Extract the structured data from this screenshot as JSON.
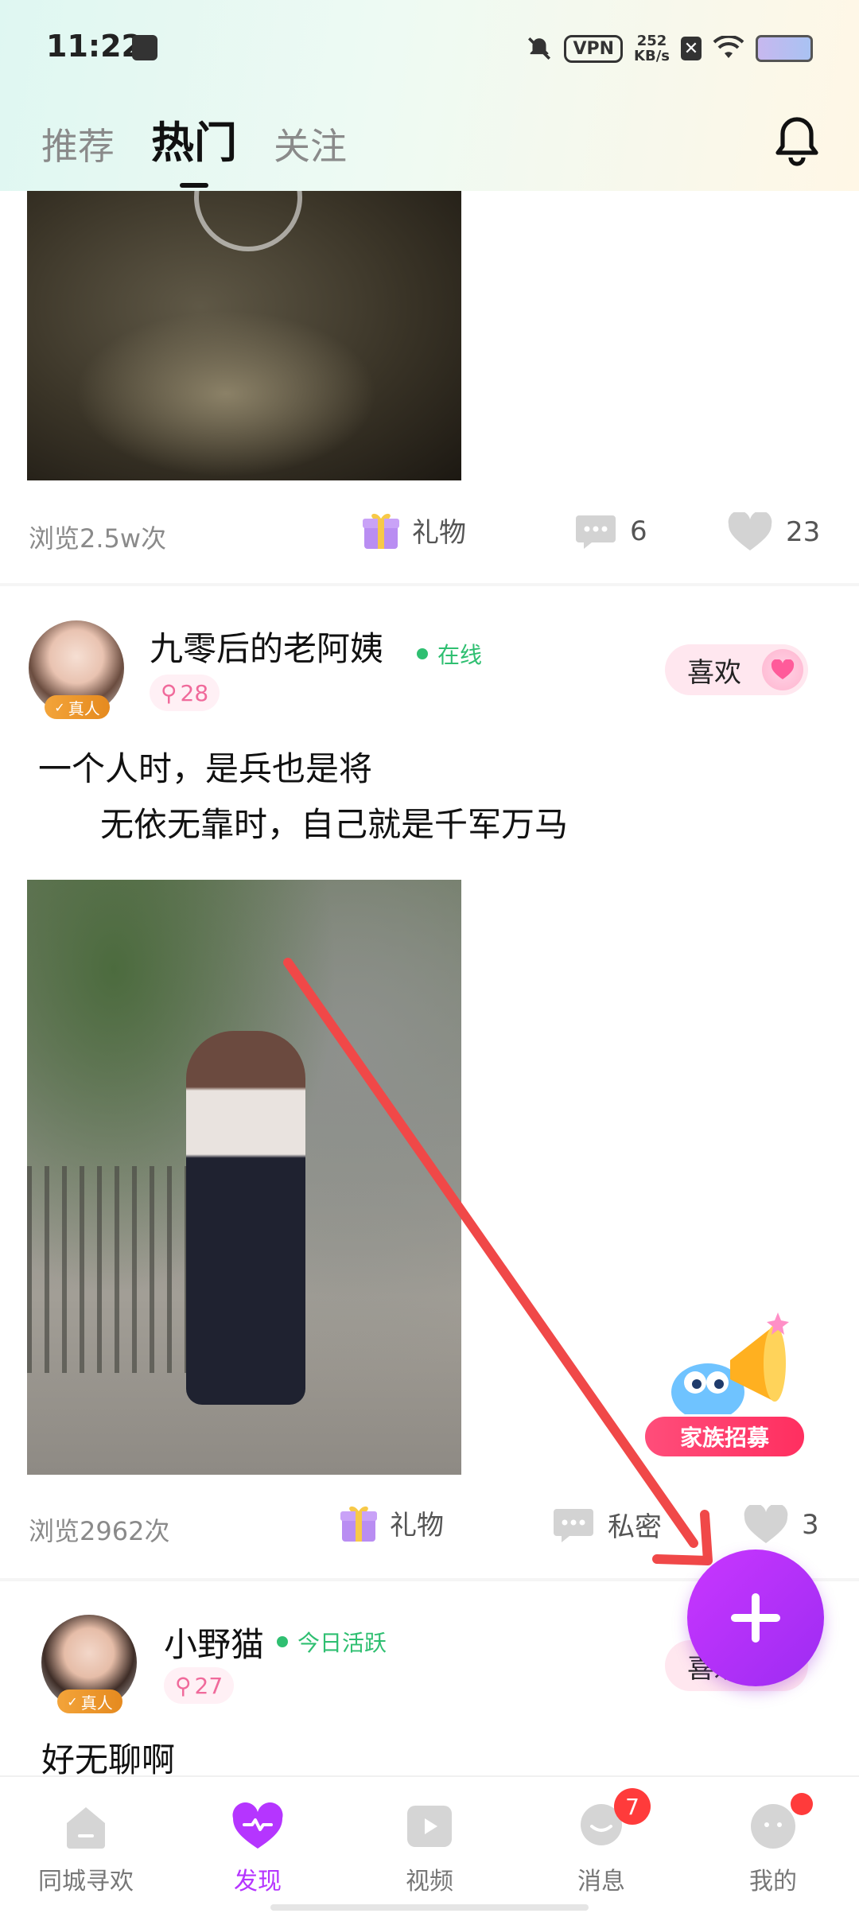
{
  "status_bar": {
    "time": "11:22",
    "vpn": "VPN",
    "speed_value": "252",
    "speed_unit": "KB/s"
  },
  "header": {
    "tabs": [
      {
        "label": "推荐"
      },
      {
        "label": "热门"
      },
      {
        "label": "关注"
      }
    ],
    "active_tab": "热门",
    "bell_icon": "bell-icon"
  },
  "posts": [
    {
      "views": "浏览2.5w次",
      "gift_label": "礼物",
      "comment_count": "6",
      "like_count": "23"
    },
    {
      "username": "九零后的老阿姨",
      "status": "在线",
      "badge": "真人",
      "level": "28",
      "like_button": "喜欢",
      "text_line1": "一个人时，是兵也是将",
      "text_line2": "无依无靠时，自己就是千军万马",
      "views": "浏览2962次",
      "gift_label": "礼物",
      "chat_label": "私密",
      "like_count": "3"
    },
    {
      "username": "小野猫",
      "status": "今日活跃",
      "badge": "真人",
      "level": "27",
      "like_button": "喜欢",
      "text": "好无聊啊"
    }
  ],
  "family_sticker": {
    "label": "家族招募"
  },
  "bottom_nav": {
    "items": [
      {
        "label": "同城寻欢"
      },
      {
        "label": "发现"
      },
      {
        "label": "视频"
      },
      {
        "label": "消息",
        "badge": "7"
      },
      {
        "label": "我的"
      }
    ],
    "active": "发现"
  },
  "colors": {
    "accent": "#b535ff",
    "online": "#2fbf71",
    "annotation_arrow": "#f04848"
  }
}
